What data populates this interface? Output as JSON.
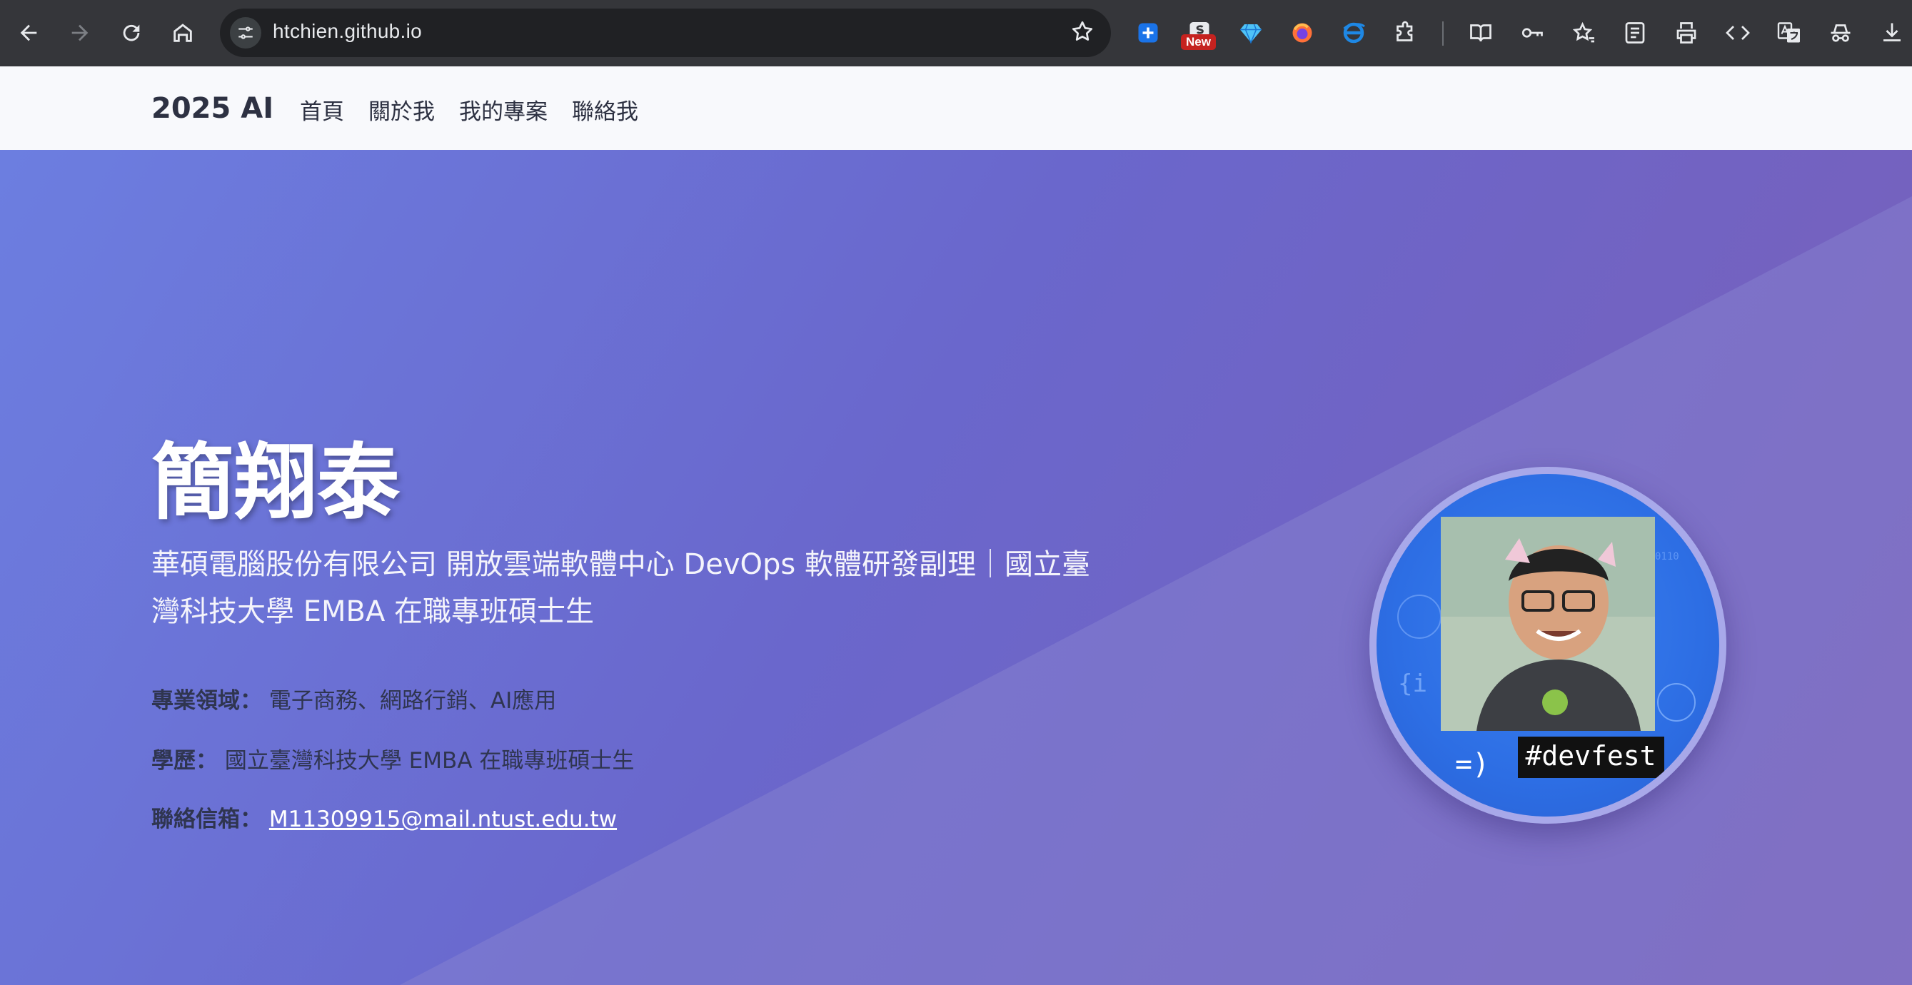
{
  "browser": {
    "url": "htchien.github.io",
    "new_badge": "New"
  },
  "site": {
    "brand": "2025 AI",
    "nav": [
      "首頁",
      "關於我",
      "我的專案",
      "聯絡我"
    ]
  },
  "hero": {
    "name": "簡翔泰",
    "title": "華碩電腦股份有限公司 開放雲端軟體中心 DevOps 軟體研發副理｜國立臺灣科技大學 EMBA 在職專班碩士生",
    "fields": [
      {
        "label": "專業領域：",
        "value": "電子商務、網路行銷、AI應用"
      },
      {
        "label": "學歷：",
        "value": "國立臺灣科技大學 EMBA 在職專班碩士生"
      },
      {
        "label": "聯絡信箱：",
        "value": "M11309915@mail.ntust.edu.tw"
      }
    ],
    "avatar_tag": "#devfest"
  },
  "colors": {
    "hero_start": "#6c7ee0",
    "hero_end": "#7a5fb8",
    "header_bg": "#f8f9fc",
    "browser_bar": "#35363a"
  }
}
